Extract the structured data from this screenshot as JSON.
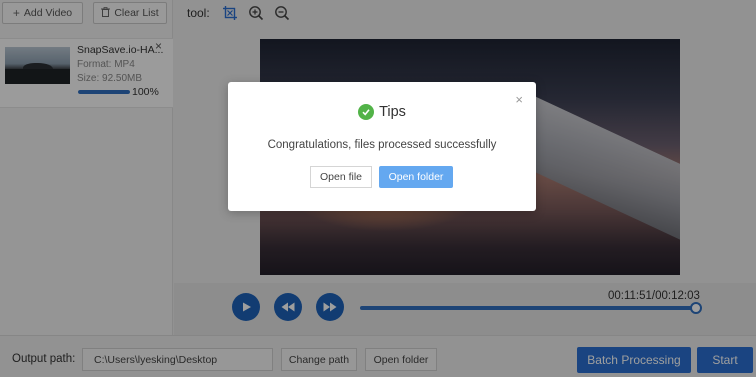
{
  "sidebar": {
    "add_video_label": "Add Video",
    "clear_list_label": "Clear List",
    "item": {
      "name": "SnapSave.io-HA...",
      "format": "Format:  MP4",
      "size": "Size:  92.50MB",
      "progress_percent": 100,
      "progress_label": "100%",
      "close_glyph": "×"
    }
  },
  "toolbar": {
    "label": "tool:",
    "icons": [
      "crop-icon",
      "zoom-in-icon",
      "zoom-out-icon"
    ]
  },
  "player": {
    "time": "00:11:51/00:12:03",
    "seek_fraction": 0.983
  },
  "bottombar": {
    "output_label": "Output path:",
    "output_path": "C:\\Users\\lyesking\\Desktop",
    "change_path_label": "Change path",
    "open_folder_label": "Open folder",
    "batch_label": "Batch Processing",
    "start_label": "Start"
  },
  "modal": {
    "title": "Tips",
    "message": "Congratulations, files processed successfully",
    "open_file_label": "Open file",
    "open_folder_label": "Open folder",
    "close_glyph": "×"
  },
  "colors": {
    "primary": "#2a6fd0",
    "modal_primary": "#64a8f0",
    "success": "#52b348"
  }
}
